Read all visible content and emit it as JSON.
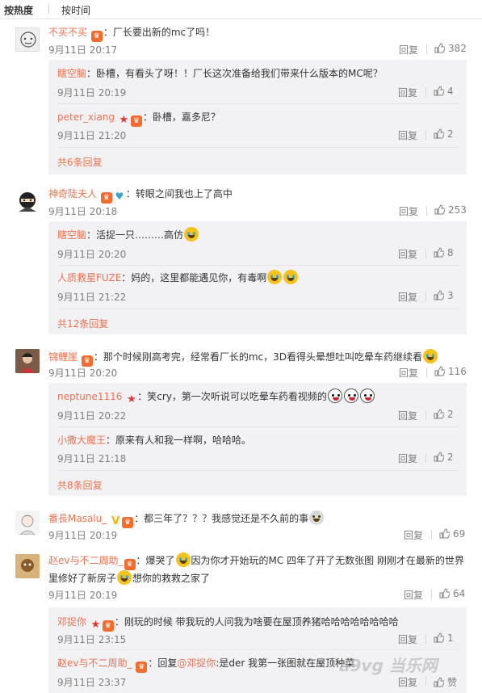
{
  "sort": {
    "hot": "按热度",
    "time": "按时间"
  },
  "actions": {
    "reply": "回复",
    "like_final": "赞"
  },
  "comments": [
    {
      "user": "不买不买",
      "sep": "：",
      "text": "厂长要出新的mc了吗！",
      "time": "9月11日 20:17",
      "likes": "382",
      "replies": [
        {
          "user": "瞎空脑",
          "sep": "：",
          "text": "卧槽，有看头了呀！！厂长这次准备给我们带来什么版本的MC呢？",
          "time": "9月11日 20:19",
          "likes": "4"
        },
        {
          "user": "peter_xiang",
          "sep": "：",
          "text": "卧槽，嘉多尼？",
          "time": "9月11日 21:20",
          "likes": "2"
        }
      ],
      "more": "共6条回复"
    },
    {
      "user": "神奇陡夫人",
      "sep": "：",
      "text": "转眼之间我也上了高中",
      "time": "9月11日 20:18",
      "likes": "253",
      "replies": [
        {
          "user": "瞎空脑",
          "sep": "：",
          "text": "活捉一只………高仿",
          "time": "9月11日 20:20",
          "likes": "8"
        },
        {
          "user": "人质救星FUZE",
          "sep": "：",
          "text": "妈的，这里都能遇见你，有毒啊",
          "time": "9月11日 21:22",
          "likes": "3"
        }
      ],
      "more": "共12条回复"
    },
    {
      "user": "锦鲤崖",
      "sep": "：",
      "text": "那个时候刚高考完，经常看厂长的mc，3D看得头晕想吐叫吃晕车药继续看",
      "time": "9月11日 20:20",
      "likes": "116",
      "replies": [
        {
          "user": "neptune1116",
          "sep": "：",
          "text": "笑cry，第一次听说可以吃晕车药看视频的",
          "time": "9月11日 20:22",
          "likes": "2"
        },
        {
          "user": "小撒大魔王",
          "sep": "：",
          "text": "原来有人和我一样啊，哈哈哈。",
          "time": "9月11日 21:18",
          "likes": "2"
        }
      ],
      "more": "共8条回复"
    },
    {
      "user": "番長Masalu_",
      "sep": "：",
      "text": "都三年了？？？我感觉还是不久前的事",
      "time": "9月11日 20:19",
      "likes": "69",
      "replies": [],
      "more": ""
    },
    {
      "user": "赵ev与不二周助_",
      "sep": "：",
      "text_a": "爆哭了",
      "text_b": "因为你才开始玩的MC 四年了开了无数张图 刚刚才在最新的世界里修好了新房子",
      "text_c": "想你的救救之家了",
      "time": "9月11日 20:19",
      "likes": "64",
      "replies": [
        {
          "user": "邓捉你",
          "sep": "：",
          "text": "刚玩的时候 带我玩的人问我为啥要在屋顶养猪哈哈哈哈哈哈哈哈",
          "time": "9月11日 23:15",
          "likes": "1"
        },
        {
          "user": "赵ev与不二周助_",
          "sep": "：",
          "text_pre": "回复",
          "mention": "@邓捉你",
          "text": ":是der 我第一张图就在屋顶种菜",
          "time": "9月11日 23:37",
          "likes": ""
        }
      ],
      "more": ""
    }
  ],
  "watermark": "a9vg 当乐网",
  "colors": {
    "username": "#eb7350",
    "meta": "#808080",
    "reply_bg": "#f2f2f5"
  }
}
